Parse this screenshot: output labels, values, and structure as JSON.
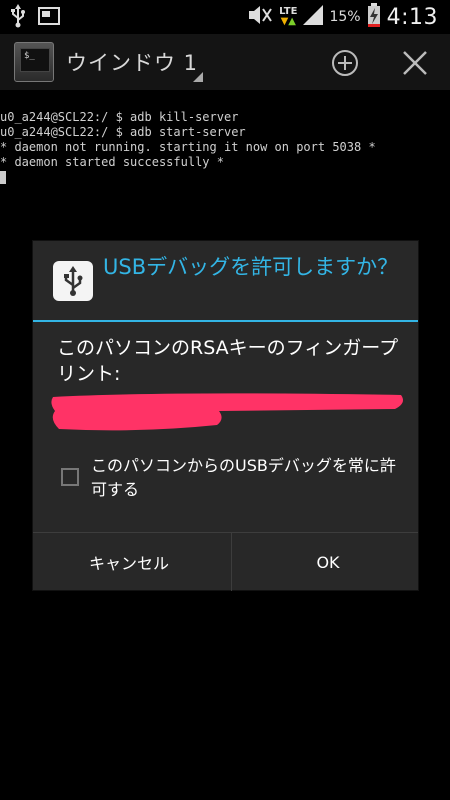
{
  "status_bar": {
    "icons": [
      "usb-icon",
      "screenshot-icon",
      "mute-icon",
      "lte-icon",
      "signal-icon",
      "battery-charging-icon"
    ],
    "lte_label": "LTE",
    "battery_percent": "15%",
    "time": "4:13"
  },
  "app_bar": {
    "window_title": "ウインドウ 1",
    "add_icon": "plus-circle-icon",
    "close_icon": "close-icon"
  },
  "terminal": {
    "lines": [
      "u0_a244@SCL22:/ $ adb kill-server",
      "u0_a244@SCL22:/ $ adb start-server",
      "* daemon not running. starting it now on port 5038 *",
      "* daemon started successfully *"
    ]
  },
  "dialog": {
    "title": "USBデバッグを許可しますか？",
    "message": "このパソコンのRSAキーのフィンガープリント:",
    "redaction_color": "#ff3366",
    "checkbox_label": "このパソコンからのUSBデバッグを常に許可する",
    "checkbox_checked": false,
    "cancel_label": "キャンセル",
    "ok_label": "OK",
    "accent_color": "#33b5e5"
  }
}
